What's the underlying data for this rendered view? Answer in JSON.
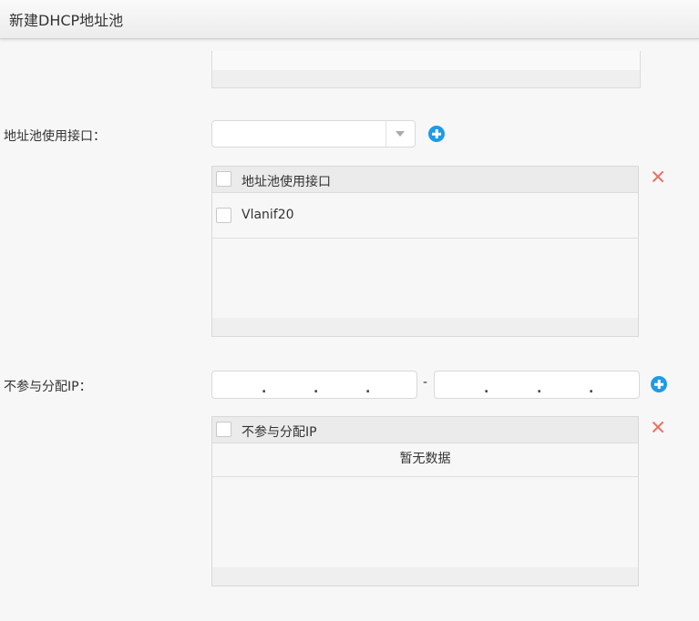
{
  "header": {
    "title": "新建DHCP地址池"
  },
  "interface_section": {
    "label": "地址池使用接口：",
    "select": {
      "value": ""
    },
    "table": {
      "column_header": "地址池使用接口",
      "rows": [
        "Vlanif20"
      ]
    }
  },
  "exclude_section": {
    "label": "不参与分配IP：",
    "range_separator": "-",
    "ip_separator": ".",
    "table": {
      "column_header": "不参与分配IP",
      "empty_text": "暂无数据"
    }
  },
  "icons": {
    "add": "add-circle-icon",
    "delete": "close-icon",
    "dropdown": "caret-down-icon"
  },
  "colors": {
    "accent": "#1e9be8",
    "delete": "#ef6d5f",
    "header_bg": "#ececec"
  }
}
